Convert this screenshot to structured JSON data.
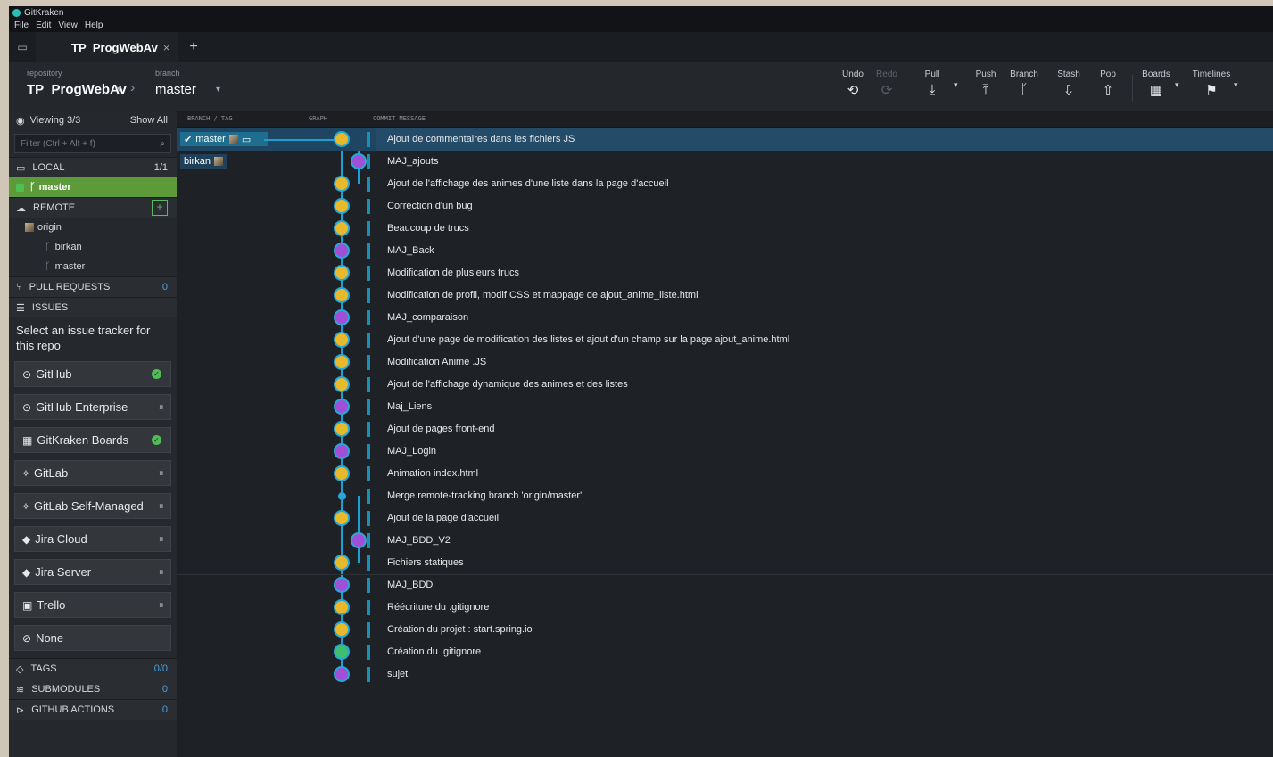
{
  "app": {
    "title": "GitKraken"
  },
  "menu": [
    "File",
    "Edit",
    "View",
    "Help"
  ],
  "tab": {
    "name": "TP_ProgWebAv",
    "close": "×",
    "add": "+"
  },
  "toolbar": {
    "repository_label": "repository",
    "branch_label": "branch",
    "repository": "TP_ProgWebAv",
    "branch": "master",
    "buttons": [
      {
        "label": "Undo",
        "icon": "undo-icon",
        "glyph": "⟲"
      },
      {
        "label": "Redo",
        "icon": "redo-icon",
        "glyph": "⟳"
      },
      {
        "label": "Pull",
        "icon": "pull-icon",
        "glyph": "⤓"
      },
      {
        "label": "Push",
        "icon": "push-icon",
        "glyph": "⤒"
      },
      {
        "label": "Branch",
        "icon": "branch-icon",
        "glyph": "ᚴ"
      },
      {
        "label": "Stash",
        "icon": "stash-icon",
        "glyph": "⇩"
      },
      {
        "label": "Pop",
        "icon": "pop-icon",
        "glyph": "⇧"
      },
      {
        "label": "Boards",
        "icon": "boards-icon",
        "glyph": "▦"
      },
      {
        "label": "Timelines",
        "icon": "timelines-icon",
        "glyph": "⚑"
      }
    ]
  },
  "sidebar": {
    "viewing": "Viewing 3/3",
    "show_all": "Show All",
    "filter_placeholder": "Filter (Ctrl + Alt + f)",
    "local": {
      "label": "LOCAL",
      "count": "1/1"
    },
    "local_branches": [
      "master"
    ],
    "remote": {
      "label": "REMOTE",
      "origin": "origin",
      "branches": [
        "birkan",
        "master"
      ]
    },
    "pull_requests": {
      "label": "PULL REQUESTS",
      "count": "0"
    },
    "issues": {
      "label": "ISSUES"
    },
    "issue_prompt": "Select an issue tracker for this repo",
    "trackers": [
      {
        "label": "GitHub",
        "state": "connected"
      },
      {
        "label": "GitHub Enterprise",
        "state": "login"
      },
      {
        "label": "GitKraken Boards",
        "state": "connected"
      },
      {
        "label": "GitLab",
        "state": "login"
      },
      {
        "label": "GitLab Self-Managed",
        "state": "login"
      },
      {
        "label": "Jira Cloud",
        "state": "login"
      },
      {
        "label": "Jira Server",
        "state": "login"
      },
      {
        "label": "Trello",
        "state": "login"
      },
      {
        "label": "None",
        "state": ""
      }
    ],
    "tags": {
      "label": "TAGS",
      "count": "0/0"
    },
    "submodules": {
      "label": "SUBMODULES",
      "count": "0"
    },
    "actions": {
      "label": "GITHUB ACTIONS",
      "count": "0"
    }
  },
  "columns": {
    "branch_tag": "BRANCH / TAG",
    "graph": "GRAPH",
    "message": "COMMIT MESSAGE"
  },
  "refs": {
    "master": "master",
    "birkan": "birkan"
  },
  "commits": [
    {
      "message": "Ajout de commentaires dans les fichiers JS",
      "author": "y"
    },
    {
      "message": "MAJ_ajouts",
      "author": "b"
    },
    {
      "message": "Ajout de l'affichage des animes d'une liste dans la page d'accueil",
      "author": "y"
    },
    {
      "message": "Correction d'un bug",
      "author": "y"
    },
    {
      "message": "Beaucoup de trucs",
      "author": "y"
    },
    {
      "message": "MAJ_Back",
      "author": "b"
    },
    {
      "message": "Modification de plusieurs trucs",
      "author": "y"
    },
    {
      "message": "Modification de profil, modif CSS et mappage de ajout_anime_liste.html",
      "author": "y"
    },
    {
      "message": "MAJ_comparaison",
      "author": "b"
    },
    {
      "message": "Ajout d'une page de modification des listes et ajout d'un champ sur la page ajout_anime.html",
      "author": "y"
    },
    {
      "message": "Modification Anime .JS",
      "author": "y"
    },
    {
      "message": "Ajout de l'affichage dynamique des animes et des listes",
      "author": "y"
    },
    {
      "message": "Maj_Liens",
      "author": "b"
    },
    {
      "message": "Ajout de pages front-end",
      "author": "y"
    },
    {
      "message": "MAJ_Login",
      "author": "b"
    },
    {
      "message": "Animation index.html",
      "author": "y"
    },
    {
      "message": "Merge remote-tracking branch 'origin/master'",
      "author": "dot"
    },
    {
      "message": "Ajout de la page d'accueil",
      "author": "y"
    },
    {
      "message": "MAJ_BDD_V2",
      "author": "b"
    },
    {
      "message": "Fichiers statiques",
      "author": "y"
    },
    {
      "message": "MAJ_BDD",
      "author": "b"
    },
    {
      "message": "Réécriture du .gitignore",
      "author": "y"
    },
    {
      "message": "Création du projet : start.spring.io",
      "author": "y"
    },
    {
      "message": "Création du .gitignore",
      "author": "g"
    },
    {
      "message": "sujet",
      "author": "b"
    }
  ]
}
